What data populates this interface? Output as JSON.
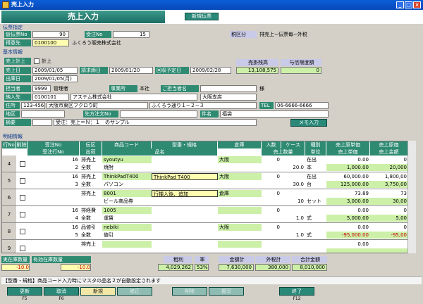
{
  "window": {
    "title": "売上入力"
  },
  "header": {
    "title": "売上入力",
    "new_button": "新規伝票"
  },
  "denpyo": {
    "section": "伝票指定",
    "kari_label": "仮伝票No",
    "kari_value": "90",
    "juchu_label": "受注No",
    "juchu_value": "15",
    "zeikubun_label": "税区分",
    "zeikubun_value": "排売上−伝票毎−外税",
    "tokui_label": "得意先",
    "tokui_code": "0100100",
    "tokui_name": "ふくろう販売株式会社"
  },
  "kihon": {
    "section": "基本情報",
    "uriage_keijo": "売上計上",
    "keijo": "計上",
    "uriage_bi_label": "売上日",
    "uriage_bi": "2009/01/05",
    "seikyu_label": "請求締日",
    "seikyu": "2009/01/20",
    "kaishu_label": "回収予定日",
    "kaishu": "2009/02/28",
    "shukka_label": "出庫日",
    "shukka": "2009/01/05(月)",
    "zandaka_label": "売掛残高",
    "zandaka": "13,108,575",
    "yoshin_label": "与信限度額",
    "yoshin": "0",
    "tanto_label": "担当者",
    "tanto_code": "9999",
    "tanto_name": "管理者",
    "jigyosho_label": "事業所",
    "jigyosho": "本社",
    "goirai_label": "ご担当者名",
    "sama": "様",
    "nonyu_label": "納入先",
    "nonyu_code": "0100101",
    "nonyu_name": "アステム株式会社",
    "nonyu_shiten": "大阪支店",
    "jusho_label": "住所",
    "zip": "123-456",
    "addr1": "大阪市東区フクロウ町",
    "addr2": "ふくろう通り１−２−３",
    "tel_label": "TEL",
    "tel": "06-6666-6666",
    "chiku_label": "地区",
    "sakichu_label": "先方注文No",
    "kenmei_label": "件名",
    "kenmei": "福袋",
    "tekiyo_label": "摘要",
    "tekiyo": "受注：売上＝Ｎ：１　のサンプル",
    "memo_button": "メモ入力"
  },
  "meisai": {
    "section": "明細情報",
    "headers1": [
      "行No",
      "削除",
      "受注No",
      "伝区",
      "商品コード",
      "型番・規格",
      "倉庫",
      "入数",
      "ケース",
      "種別",
      "売上原単価",
      "売上原価"
    ],
    "headers2": [
      "受注行No",
      "出荷",
      "品名",
      "売上数量",
      "単位",
      "売上単価",
      "売上金額"
    ],
    "rows": [
      {
        "no": "4",
        "juchu": "16",
        "jno": "2",
        "den1": "排売上",
        "den2": "全数",
        "code": "syoutyu",
        "name": "焼酎",
        "kata": "",
        "soko": "大阪",
        "irisu": "0",
        "case": "20.0",
        "shubetsu": "在出",
        "tani": "本",
        "genka_tanka": "0.00",
        "tanka": "1,000.00",
        "genka": "0",
        "kingaku": "20,000"
      },
      {
        "no": "5",
        "juchu": "16",
        "jno": "3",
        "den1": "排売上",
        "den2": "全数",
        "code": "ThinkPadT400",
        "name": "パソコン",
        "kata": "ThinkPad T400",
        "soko": "大阪",
        "irisu": "0",
        "case": "30.0",
        "shubetsu": "在出",
        "tani": "台",
        "genka_tanka": "60,000.00",
        "tanka": "125,000.00",
        "genka": "1,800,00",
        "kingaku": "3,750,00"
      },
      {
        "no": "6",
        "juchu": "",
        "jno": "",
        "den1": "排売上",
        "den2": "",
        "code": "8001",
        "name": "ビール商品券",
        "kata": "行挿入後、追加",
        "soko": "倉庫",
        "irisu": "0",
        "case": "10",
        "shubetsu": "",
        "tani": "セット",
        "genka_tanka": "73.89",
        "tanka": "3,000.00",
        "genka": "73",
        "kingaku": "30,00"
      },
      {
        "no": "7",
        "juchu": "16",
        "jno": "4",
        "den1": "排経費",
        "den2": "全数",
        "code": "1005",
        "name": "運賃",
        "kata": "",
        "soko": "",
        "irisu": "0",
        "case": "1.0",
        "shubetsu": "",
        "tani": "式",
        "genka_tanka": "0.00",
        "tanka": "5,000.00",
        "genka": "0",
        "kingaku": "5,00"
      },
      {
        "no": "8",
        "juchu": "16",
        "jno": "5",
        "den1": "品値引",
        "den2": "全数",
        "code": "nebiki",
        "name": "値引",
        "kata": "",
        "soko": "大阪",
        "irisu": "0",
        "case": "1.0",
        "shubetsu": "",
        "tani": "式",
        "genka_tanka": "0.00",
        "tanka": "-95,000.00",
        "genka": "0",
        "kingaku": "-95,00"
      },
      {
        "no": "9",
        "juchu": "",
        "jno": "",
        "den1": "排売上",
        "den2": "",
        "code": "",
        "name": "",
        "kata": "",
        "soko": "",
        "irisu": "",
        "case": "",
        "shubetsu": "",
        "tani": "",
        "genka_tanka": "0.00",
        "tanka": "",
        "genka": "",
        "kingaku": ""
      }
    ]
  },
  "totals": {
    "zaiko_label": "実在庫数量",
    "zaiko": "-10.0",
    "yuko_label": "有効在庫数量",
    "yuko": "-10.0",
    "arari_label": "粗利",
    "arari": "4,029,262",
    "ritsu_label": "率",
    "ritsu": "53%",
    "kingaku_label": "金額計",
    "kingaku": "7,630,000",
    "zei_label": "外税計",
    "zei": "380,000",
    "gokei_label": "合計金額",
    "gokei": "8,010,000"
  },
  "message": "【型番・規格】商品コード入力時にマスタの品名２が自動設定されます",
  "footer": [
    {
      "label": "更新",
      "key": "F5"
    },
    {
      "label": "取消",
      "key": "F6"
    },
    {
      "label": "新規",
      "key": ""
    },
    {
      "label": "修正",
      "key": ""
    },
    {
      "label": "削除",
      "key": ""
    },
    {
      "label": "複写",
      "key": ""
    },
    {
      "label": "終了",
      "key": "F12"
    }
  ],
  "colors": {
    "accent": "#2e8b72",
    "title_bar": "#0a5fd8",
    "lime": "#ccf0a8",
    "yellow": "#fffeb0"
  }
}
